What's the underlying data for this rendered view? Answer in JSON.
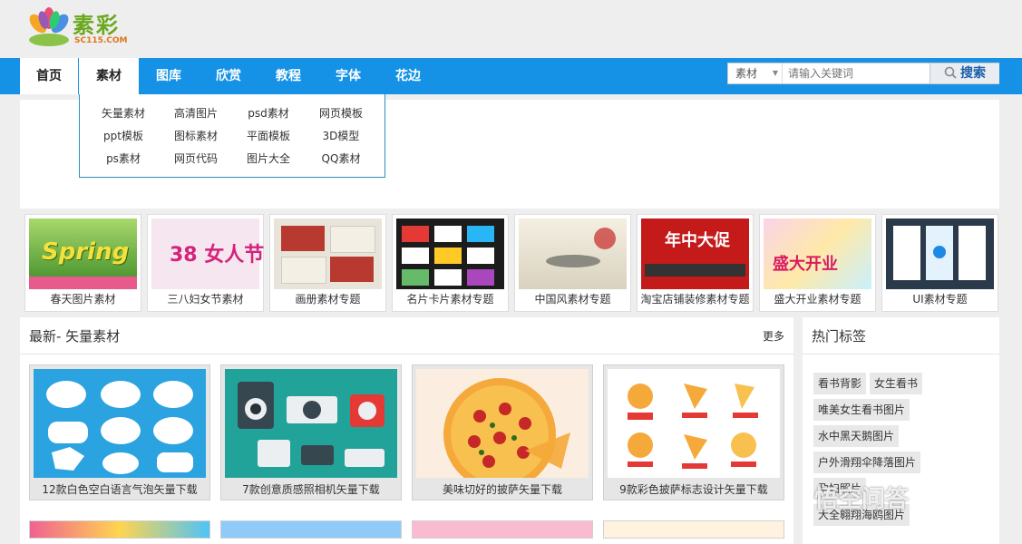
{
  "logo": {
    "text": "素彩",
    "url": "SC115.COM"
  },
  "nav": {
    "items": [
      "首页",
      "素材",
      "图库",
      "欣赏",
      "教程",
      "字体",
      "花边"
    ]
  },
  "search": {
    "category": "素材",
    "placeholder": "请输入关键词",
    "button": "搜索"
  },
  "dropdown": {
    "items": [
      "矢量素材",
      "高清图片",
      "psd素材",
      "网页模板",
      "ppt模板",
      "图标素材",
      "平面模板",
      "3D模型",
      "ps素材",
      "网页代码",
      "图片大全",
      "QQ素材"
    ]
  },
  "topics": [
    {
      "label": "春天图片素材",
      "img_text": "Spring"
    },
    {
      "label": "三八妇女节素材",
      "img_text": "38 女人节"
    },
    {
      "label": "画册素材专题",
      "img_text": ""
    },
    {
      "label": "名片卡片素材专题",
      "img_text": ""
    },
    {
      "label": "中国风素材专题",
      "img_text": ""
    },
    {
      "label": "淘宝店铺装修素材专题",
      "img_text": "年中大促"
    },
    {
      "label": "盛大开业素材专题",
      "img_text": "盛大开业"
    },
    {
      "label": "UI素材专题",
      "img_text": ""
    }
  ],
  "latest": {
    "title": "最新- 矢量素材",
    "more": "更多",
    "items": [
      "12款白色空白语言气泡矢量下载",
      "7款创意质感照相机矢量下载",
      "美味切好的披萨矢量下载",
      "9款彩色披萨标志设计矢量下载"
    ]
  },
  "hot_tags": {
    "title": "热门标签",
    "tags": [
      "看书背影",
      "女生看书",
      "唯美女生看书图片",
      "水中黑天鹅图片",
      "户外滑翔伞降落图片",
      "孕妇照片",
      "大全翱翔海鸥图片"
    ]
  },
  "watermark": "悟空问答",
  "colors": {
    "nav": "#1592e6",
    "logo_green": "#6aa81e",
    "search_btn_text": "#1a5fa8"
  }
}
